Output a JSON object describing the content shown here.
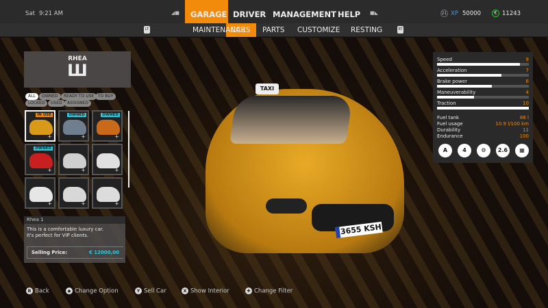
{
  "status": {
    "day": "Sat",
    "time": "9:21 AM",
    "level": "21",
    "xp_label": "XP",
    "xp": "50000",
    "money": "11243"
  },
  "nav": {
    "tabs": [
      "GARAGE",
      "DRIVER",
      "MANAGEMENT",
      "HELP"
    ],
    "active": "GARAGE",
    "left_bumper": "LB",
    "right_bumper": "RB"
  },
  "subnav": {
    "tabs": [
      "MAINTENANCE",
      "CARS",
      "PARTS",
      "CUSTOMIZE",
      "RESTING"
    ],
    "active": "CARS",
    "left_trigger": "LT",
    "right_trigger": "RT"
  },
  "brand": {
    "name": "RHEA"
  },
  "filters": [
    "ALL",
    "OWNED",
    "READY TO USE",
    "TO BUY",
    "LOCKED",
    "USED",
    "ASSIGNED"
  ],
  "active_filter": "ALL",
  "cars": [
    {
      "badge": "IN USE",
      "badge_color": "#f28a0c",
      "color": "#d99a1a"
    },
    {
      "badge": "OWNED",
      "badge_color": "#2ec9e0",
      "color": "#6f7f90"
    },
    {
      "badge": "OWNED",
      "badge_color": "#2ec9e0",
      "color": "#c96a1a"
    },
    {
      "badge": "OWNED",
      "badge_color": "#2ec9e0",
      "color": "#c82020"
    },
    {
      "badge": "",
      "color": "#cfcfcf"
    },
    {
      "badge": "",
      "color": "#e0e0e0"
    },
    {
      "badge": "",
      "color": "#e6e6e6"
    },
    {
      "badge": "",
      "color": "#d8d8d8"
    },
    {
      "badge": "",
      "color": "#dcdcdc"
    }
  ],
  "details": {
    "name": "Rhea 1",
    "description": "This is a comfortable luxury car. It's perfect for VIP clients.",
    "price_label": "Selling Price:",
    "price": "€ 12000,00"
  },
  "stats": [
    {
      "label": "Speed",
      "value": 9
    },
    {
      "label": "Acceleration",
      "value": 7
    },
    {
      "label": "Brake power",
      "value": 6
    },
    {
      "label": "Maneuverability",
      "value": 4
    },
    {
      "label": "Traction",
      "value": 10
    }
  ],
  "specs": [
    {
      "label": "Fuel tank",
      "value": "88 l"
    },
    {
      "label": "Fuel usage",
      "value": "10.9 l/100 km"
    },
    {
      "label": "Durability",
      "value": "11"
    },
    {
      "label": "Endurance",
      "value": "100"
    }
  ],
  "feature_icons": [
    {
      "name": "auto-transmission-icon",
      "text": "A"
    },
    {
      "name": "seats-icon",
      "text": "4"
    },
    {
      "name": "engine-icon",
      "text": "⚙"
    },
    {
      "name": "weight-icon",
      "text": "2.6"
    },
    {
      "name": "chassis-icon",
      "text": "▦"
    }
  ],
  "taxi": {
    "sign": "TAXI",
    "plate": "3655 KSH",
    "color": "#e0a020"
  },
  "hints": [
    {
      "button": "B",
      "label": "Back"
    },
    {
      "button": "◆",
      "label": "Change Option"
    },
    {
      "button": "Y",
      "label": "Sell Car"
    },
    {
      "button": "X",
      "label": "Show Interior"
    },
    {
      "button": "✚",
      "label": "Change Filter"
    }
  ]
}
